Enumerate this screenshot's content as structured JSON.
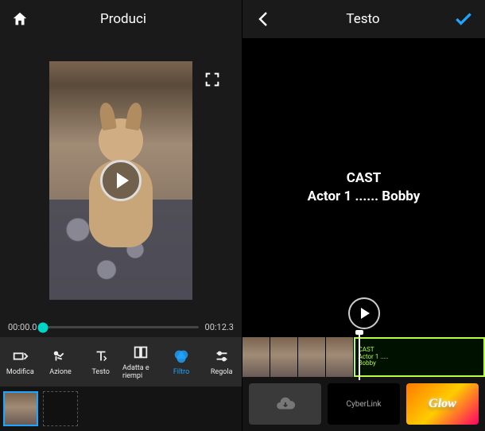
{
  "left": {
    "header": {
      "title": "Produci"
    },
    "time": {
      "current": "00:00.0",
      "total": "00:12.3"
    },
    "tools": [
      {
        "label": "Modifica",
        "key": "modifica"
      },
      {
        "label": "Azione",
        "key": "azione"
      },
      {
        "label": "Testo",
        "key": "testo"
      },
      {
        "label": "Adatta e riempi",
        "key": "adatta"
      },
      {
        "label": "Filtro",
        "key": "filtro",
        "selected": true
      },
      {
        "label": "Regola",
        "key": "regola"
      }
    ]
  },
  "right": {
    "header": {
      "title": "Testo"
    },
    "cast": {
      "line1": "CAST",
      "line2": "Actor 1 ...... Bobby"
    },
    "clip_text": {
      "l1": "CAST",
      "l2": "Actor 1 .....",
      "l3": "Bobby"
    },
    "presets": {
      "cyberlink": "CyberLink",
      "glow": "Glow"
    }
  }
}
